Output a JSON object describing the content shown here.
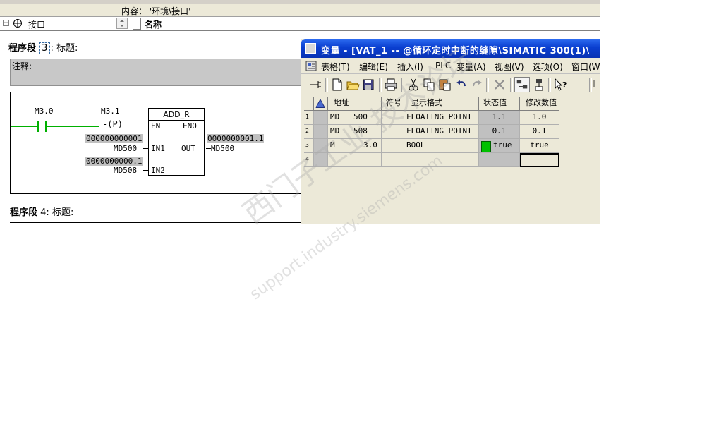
{
  "header": {
    "content_label": "内容：  '环境\\接口'",
    "interface_label": "接口",
    "name_column": "名称",
    "tree_toggle": "⊟"
  },
  "network3": {
    "prefix": "程序段",
    "number": "3",
    "suffix": ": 标题:",
    "comment_label": "注释:",
    "contact1": "M3.0",
    "contact2": "M3.1",
    "edge_label": "P",
    "block_name": "ADD_R",
    "pin_en": "EN",
    "pin_eno": "ENO",
    "pin_in1": "IN1",
    "pin_in2": "IN2",
    "pin_out": "OUT",
    "in1_value": "000000000001",
    "in1_addr": "MD500",
    "in2_value": "0000000000.1",
    "in2_addr": "MD508",
    "out_value": "0000000001.1",
    "out_addr": "MD500"
  },
  "network4": {
    "prefix": "程序段",
    "label": "4: 标题:"
  },
  "vat": {
    "title": "变量  - [VAT_1 -- @循环定时中断的缝隙\\SIMATIC 300(1)\\",
    "menus": [
      "表格(T)",
      "编辑(E)",
      "插入(I)",
      "PLC",
      "变量(A)",
      "视图(V)",
      "选项(O)",
      "窗口(W)"
    ],
    "columns": [
      "地址",
      "符号",
      "显示格式",
      "状态值",
      "修改数值"
    ],
    "rows": [
      {
        "num": "1",
        "addr_type": "MD",
        "addr_val": "500",
        "symbol": "",
        "format": "FLOATING_POINT",
        "status": "1.1",
        "modify": "1.0"
      },
      {
        "num": "2",
        "addr_type": "MD",
        "addr_val": "508",
        "symbol": "",
        "format": "FLOATING_POINT",
        "status": "0.1",
        "modify": "0.1"
      },
      {
        "num": "3",
        "addr_type": "M",
        "addr_val": "3.0",
        "symbol": "",
        "format": "BOOL",
        "status": "true",
        "modify": "true"
      },
      {
        "num": "4",
        "addr_type": "",
        "addr_val": "",
        "symbol": "",
        "format": "",
        "status": "",
        "modify": ""
      }
    ],
    "colors": {
      "title_bar": "#0a3fd0",
      "status_bg": "#c0c0c0",
      "bool_true": "#00c000"
    }
  },
  "watermark": {
    "text": "西门子工业 技术论坛",
    "url": "support.industry.siemens.com"
  }
}
